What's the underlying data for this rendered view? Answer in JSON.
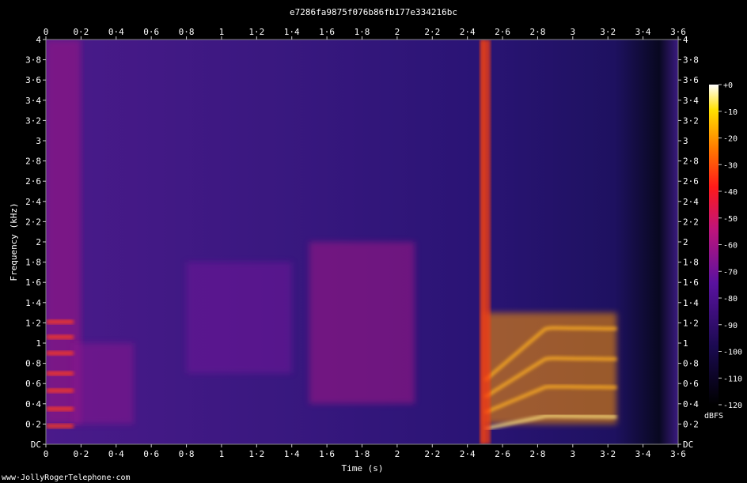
{
  "chart_data": {
    "type": "heatmap",
    "title": "e7286fa9875f076b86fb177e334216bc",
    "xlabel": "Time (s)",
    "ylabel": "Frequency (kHz)",
    "x_ticks": [
      "0",
      "0·2",
      "0·4",
      "0·6",
      "0·8",
      "1",
      "1·2",
      "1·4",
      "1·6",
      "1·8",
      "2",
      "2·2",
      "2·4",
      "2·6",
      "2·8",
      "3",
      "3·2",
      "3·4",
      "3·6"
    ],
    "x_tick_values": [
      0,
      0.2,
      0.4,
      0.6,
      0.8,
      1,
      1.2,
      1.4,
      1.6,
      1.8,
      2,
      2.2,
      2.4,
      2.6,
      2.8,
      3,
      3.2,
      3.4,
      3.6
    ],
    "y_ticks": [
      "DC",
      "0·2",
      "0·4",
      "0·6",
      "0·8",
      "1",
      "1·2",
      "1·4",
      "1·6",
      "1·8",
      "2",
      "2·2",
      "2·4",
      "2·6",
      "2·8",
      "3",
      "3·2",
      "3·4",
      "3·6",
      "3·8",
      "4"
    ],
    "y_tick_values": [
      0,
      0.2,
      0.4,
      0.6,
      0.8,
      1,
      1.2,
      1.4,
      1.6,
      1.8,
      2,
      2.2,
      2.4,
      2.6,
      2.8,
      3,
      3.2,
      3.4,
      3.6,
      3.8,
      4
    ],
    "xlim": [
      0,
      3.6
    ],
    "ylim": [
      0,
      4
    ],
    "colorbar": {
      "label": "dBFS",
      "ticks": [
        "+0",
        "-10",
        "-20",
        "-30",
        "-40",
        "-50",
        "-60",
        "-70",
        "-80",
        "-90",
        "-100",
        "-110",
        "-120"
      ],
      "range": [
        -120,
        0
      ]
    },
    "features": [
      {
        "x": [
          0,
          0.2
        ],
        "y": [
          0.2,
          4
        ],
        "level_db": -60
      },
      {
        "x": [
          0.15,
          0.5
        ],
        "y": [
          0.2,
          1
        ],
        "level_db": -65
      },
      {
        "x": [
          0.8,
          1.4
        ],
        "y": [
          0.7,
          1.8
        ],
        "level_db": -70
      },
      {
        "x": [
          1.5,
          2.1
        ],
        "y": [
          0.4,
          2
        ],
        "level_db": -60
      },
      {
        "x": [
          2.48,
          2.5
        ],
        "y": [
          0,
          4
        ],
        "level_db": -25
      },
      {
        "x": [
          2.5,
          3.25
        ],
        "y": [
          0.2,
          1.3
        ],
        "level_db": -20
      }
    ]
  },
  "footer": {
    "watermark": "www·JollyRogerTelephone·com"
  }
}
